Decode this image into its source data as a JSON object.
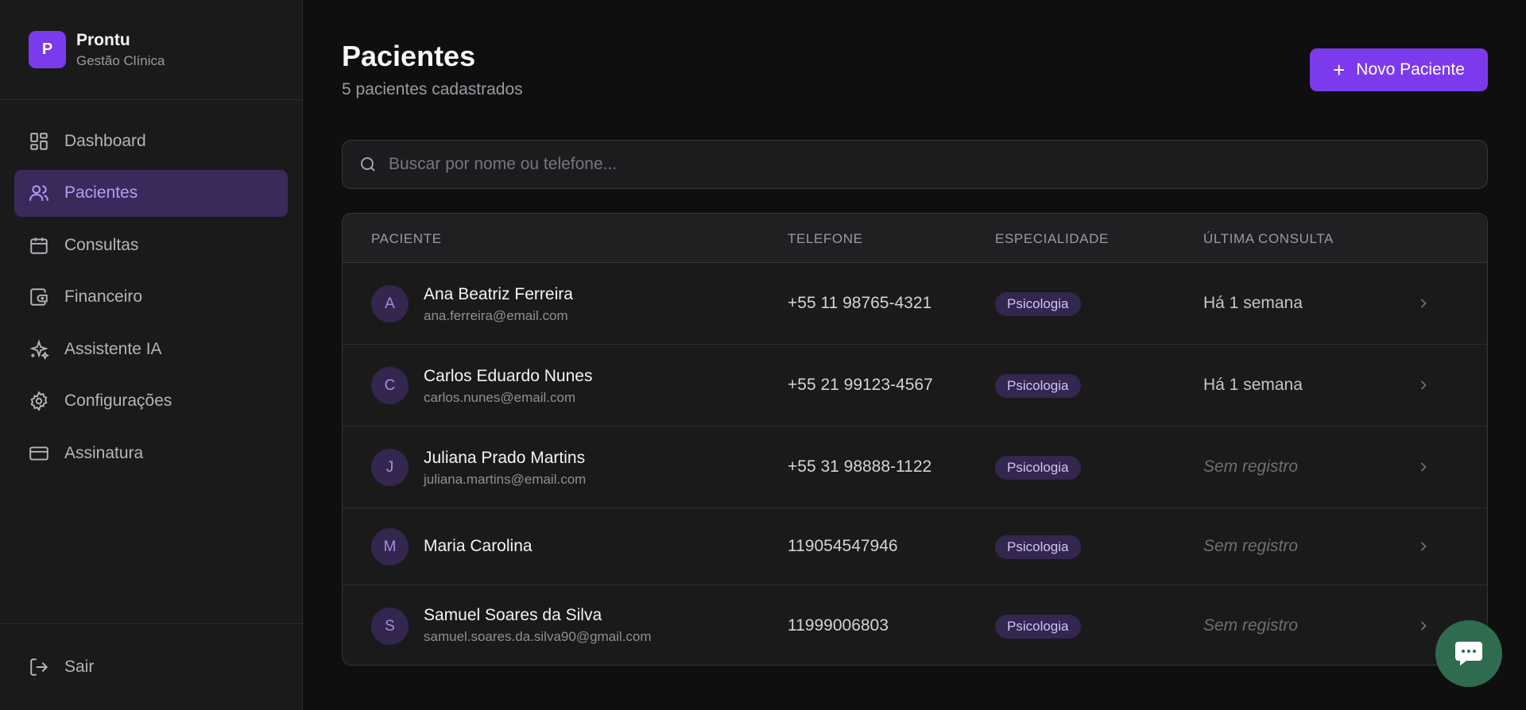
{
  "brand": {
    "logo_letter": "P",
    "name": "Prontu",
    "subtitle": "Gestão Clínica"
  },
  "nav": {
    "items": [
      {
        "label": "Dashboard",
        "icon": "dashboard-icon",
        "active": false
      },
      {
        "label": "Pacientes",
        "icon": "users-icon",
        "active": true
      },
      {
        "label": "Consultas",
        "icon": "calendar-icon",
        "active": false
      },
      {
        "label": "Financeiro",
        "icon": "wallet-icon",
        "active": false
      },
      {
        "label": "Assistente IA",
        "icon": "sparkles-icon",
        "active": false
      },
      {
        "label": "Configurações",
        "icon": "gear-icon",
        "active": false
      },
      {
        "label": "Assinatura",
        "icon": "credit-card-icon",
        "active": false
      }
    ],
    "logout_label": "Sair"
  },
  "page": {
    "title": "Pacientes",
    "subtitle": "5 pacientes cadastrados",
    "new_button_label": "Novo Paciente"
  },
  "search": {
    "placeholder": "Buscar por nome ou telefone...",
    "value": ""
  },
  "table": {
    "headers": {
      "patient": "PACIENTE",
      "phone": "TELEFONE",
      "specialty": "ESPECIALIDADE",
      "last_visit": "ÚLTIMA CONSULTA"
    },
    "rows": [
      {
        "initial": "A",
        "name": "Ana Beatriz Ferreira",
        "email": "ana.ferreira@email.com",
        "phone": "+55 11 98765-4321",
        "specialty": "Psicologia",
        "last_visit": "Há 1 semana"
      },
      {
        "initial": "C",
        "name": "Carlos Eduardo Nunes",
        "email": "carlos.nunes@email.com",
        "phone": "+55 21 99123-4567",
        "specialty": "Psicologia",
        "last_visit": "Há 1 semana"
      },
      {
        "initial": "J",
        "name": "Juliana Prado Martins",
        "email": "juliana.martins@email.com",
        "phone": "+55 31 98888-1122",
        "specialty": "Psicologia",
        "last_visit": "Sem registro"
      },
      {
        "initial": "M",
        "name": "Maria Carolina",
        "email": "",
        "phone": "119054547946",
        "specialty": "Psicologia",
        "last_visit": "Sem registro"
      },
      {
        "initial": "S",
        "name": "Samuel Soares da Silva",
        "email": "samuel.soares.da.silva90@gmail.com",
        "phone": "11999006803",
        "specialty": "Psicologia",
        "last_visit": "Sem registro"
      }
    ]
  },
  "colors": {
    "accent": "#7c3aed",
    "active_nav_bg": "#3a2a5c",
    "chat_fab": "#2f6b4f",
    "background": "#0f0f10"
  }
}
